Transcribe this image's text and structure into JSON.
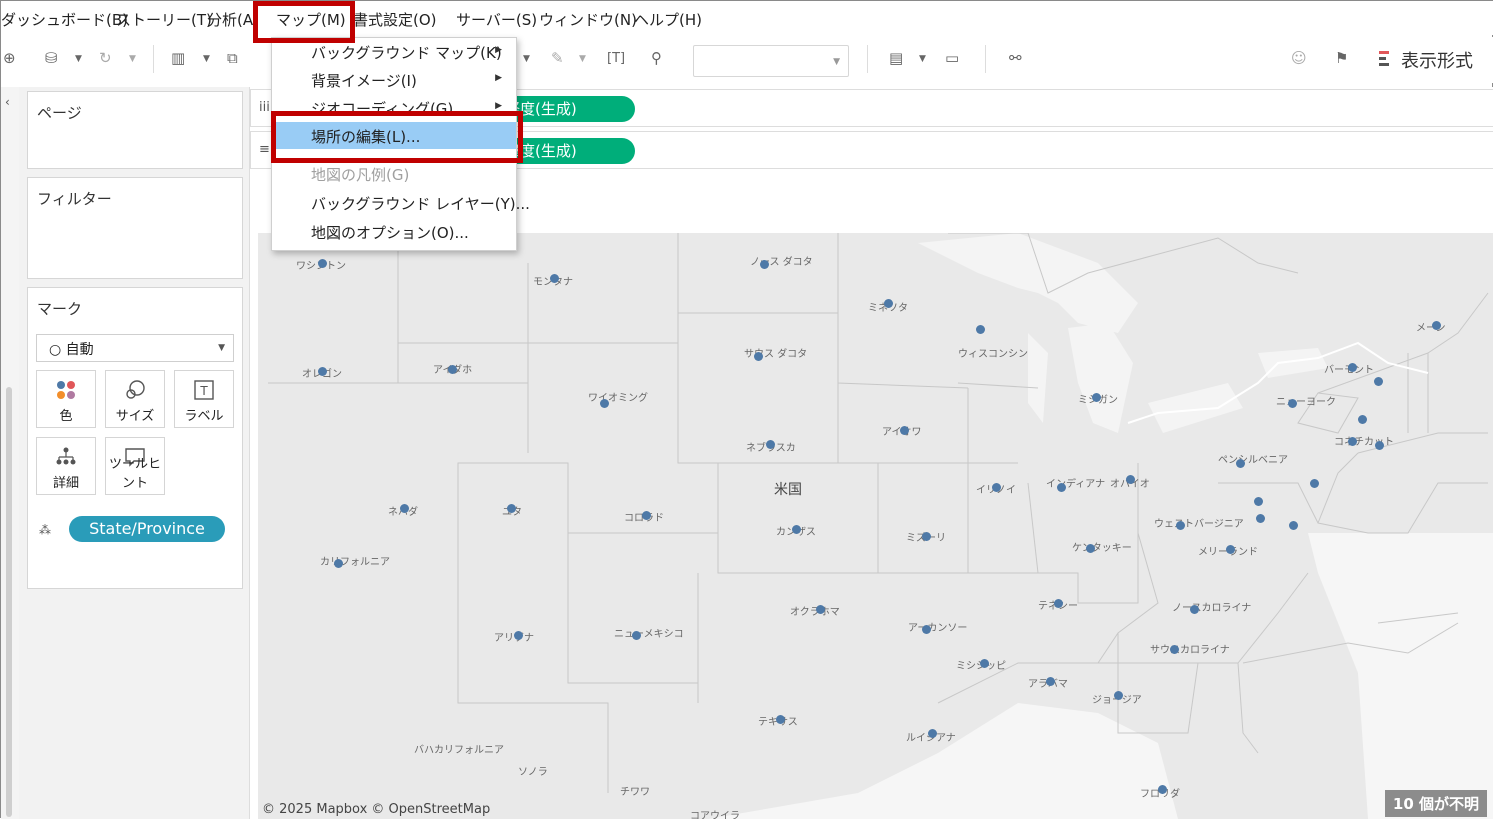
{
  "menubar": {
    "items": [
      "ダッシュボード(B)",
      "ストーリー(T)",
      "分析(A)",
      "マップ(M)",
      "書式設定(O)",
      "サーバー(S)",
      "ウィンドウ(N)",
      "ヘルプ(H)"
    ]
  },
  "toolbar": {
    "show_me_label": "表示形式"
  },
  "sidebar": {
    "pages_title": "ページ",
    "filters_title": "フィルター",
    "marks": {
      "title": "マーク",
      "mark_type": "自動",
      "buttons": [
        "色",
        "サイズ",
        "ラベル",
        "詳細",
        "ツールヒント"
      ],
      "detail_field": "State/Province"
    }
  },
  "shelves": {
    "columns_pill": "経度(生成)",
    "rows_pill": "緯度(生成)"
  },
  "map_dropdown": {
    "items": [
      {
        "label": "バックグラウンド マップ(K)",
        "submenu": true,
        "disabled": false,
        "highlighted": false
      },
      {
        "label": "背景イメージ(I)",
        "submenu": true,
        "disabled": false,
        "highlighted": false
      },
      {
        "label": "ジオコーディング(G)",
        "submenu": true,
        "disabled": false,
        "highlighted": false
      },
      {
        "label": "場所の編集(L)...",
        "submenu": false,
        "disabled": false,
        "highlighted": true
      },
      {
        "label": "地図の凡例(G)",
        "submenu": false,
        "disabled": true,
        "highlighted": false
      },
      {
        "label": "バックグラウンド レイヤー(Y)...",
        "submenu": false,
        "disabled": false,
        "highlighted": false
      },
      {
        "label": "地図のオプション(O)...",
        "submenu": false,
        "disabled": false,
        "highlighted": false
      }
    ]
  },
  "map": {
    "country_label": "米国",
    "state_labels": [
      "ワシントン",
      "モンタナ",
      "ノース ダコタ",
      "ミネソタ",
      "オレゴン",
      "アイダホ",
      "サウス ダコタ",
      "ウィスコンシン",
      "ワイオミング",
      "ミシガン",
      "ネブラスカ",
      "アイオワ",
      "ネバダ",
      "ユタ",
      "コロラド",
      "カンザス",
      "イリノイ",
      "インディアナ",
      "オハイオ",
      "カリフォルニア",
      "ミズーリ",
      "ケンタッキー",
      "ウェストバージニア",
      "ペンシルベニア",
      "ニューヨーク",
      "バーモント",
      "メーン",
      "コネチカット",
      "アリゾナ",
      "ニューメキシコ",
      "オクラホマ",
      "アーカンソー",
      "テネシー",
      "ノースカロライナ",
      "メリーランド",
      "サウスカロライナ",
      "ミシシッピ",
      "アラバマ",
      "ジョージア",
      "テキサス",
      "ルイジアナ",
      "フロリダ",
      "バハカリフォルニア",
      "ソノラ",
      "チワワ",
      "コアウイラ"
    ],
    "attribution": "© 2025 Mapbox © OpenStreetMap",
    "unknown_indicator": "10 個が不明"
  }
}
